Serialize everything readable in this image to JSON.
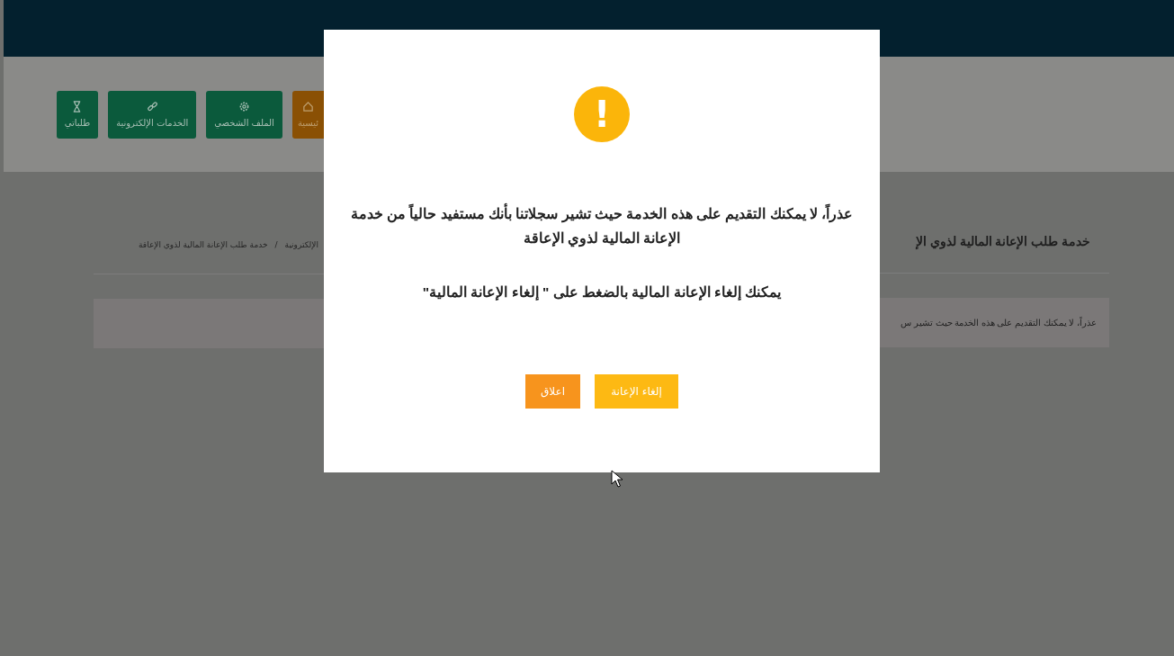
{
  "nav_buttons": [
    {
      "label": "ئيسية",
      "kind": "home",
      "selected": true
    },
    {
      "label": "الملف الشخصي",
      "kind": "gear",
      "selected": false
    },
    {
      "label": "الخدمات الإلكترونية",
      "kind": "link",
      "selected": false
    },
    {
      "label": "طلباتي",
      "kind": "hourglass",
      "selected": false
    }
  ],
  "page_heading": "خدمة طلب الإعانة المالية لذوي الإ",
  "breadcrumb": [
    "الإلكترونية",
    "خدمة طلب الإعانة المالية لذوي الإعاقة"
  ],
  "breadcrumb_separator": "/",
  "alert_text": "عذراً، لا يمكنك التقديم على هذه الخدمة حيث تشير س",
  "dialog": {
    "icon": "!",
    "message": "عذراً، لا يمكنك التقديم على هذه الخدمة حيث تشير سجلاتنا بأنك مستفيد حالياً من خدمة الإعانة المالية لذوي الإعاقة",
    "hint": "يمكنك إلغاء الإعانة المالية بالضغط على \" إلغاء الإعانة المالية\"",
    "buttons": [
      {
        "label": "إلغاء الإعانة",
        "kind": "primary"
      },
      {
        "label": "اعلاق",
        "kind": "secondary"
      }
    ]
  }
}
